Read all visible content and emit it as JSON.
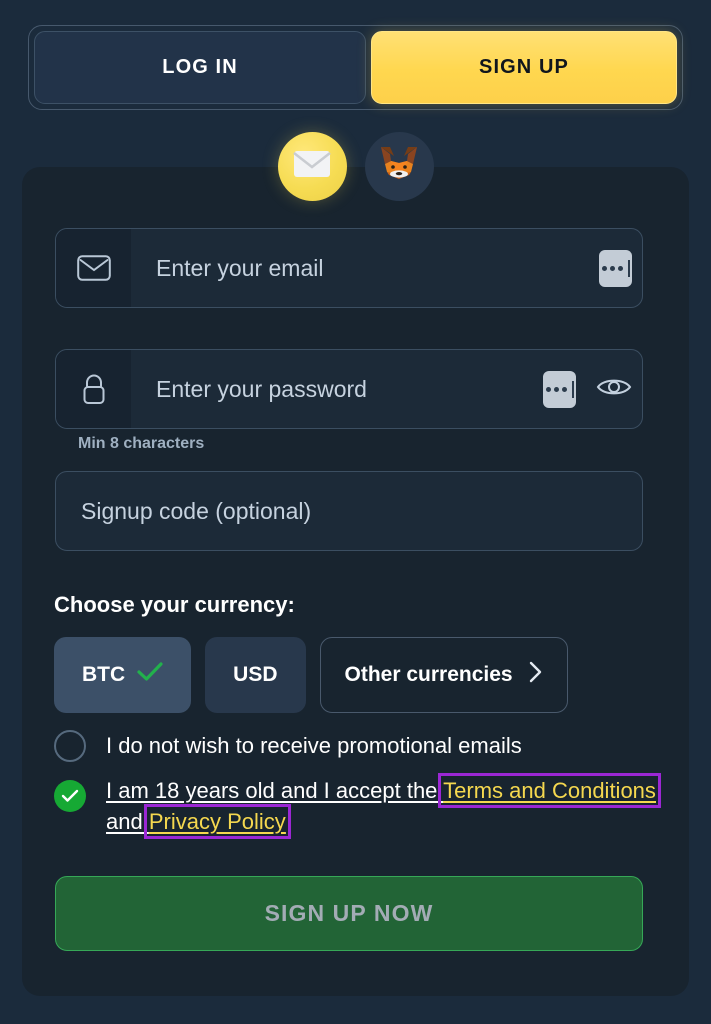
{
  "auth_tabs": {
    "login_label": "LOG IN",
    "signup_label": "SIGN UP",
    "active": "SIGN UP"
  },
  "providers": [
    {
      "name": "email",
      "icon": "envelope-icon",
      "selected": true
    },
    {
      "name": "metamask",
      "icon": "metamask-fox-icon",
      "selected": false
    }
  ],
  "form": {
    "email": {
      "icon": "envelope-icon",
      "placeholder": "Enter your email",
      "value": "",
      "autofill_icon": "autofill-dots-icon"
    },
    "password": {
      "icon": "lock-icon",
      "placeholder": "Enter your password",
      "value": "",
      "autofill_icon": "autofill-dots-icon",
      "reveal_icon": "eye-icon",
      "hint": "Min 8 characters"
    },
    "signup_code": {
      "placeholder": "Signup code (optional)",
      "value": ""
    }
  },
  "currency": {
    "label": "Choose your currency:",
    "options": [
      {
        "label": "BTC",
        "selected": true,
        "check_icon": "check-icon"
      },
      {
        "label": "USD",
        "selected": false
      },
      {
        "label": "Other currencies",
        "selected": false,
        "chevron_icon": "chevron-right-icon"
      }
    ]
  },
  "consents": [
    {
      "name": "promotional-emails",
      "checked": false,
      "label": "I do not wish to receive promotional emails"
    },
    {
      "name": "age-and-terms",
      "checked": true,
      "label_part1": "I am 18 years old and I accept the ",
      "link1": "Terms and Conditions",
      "label_part2": " and ",
      "link2": "Privacy Policy"
    }
  ],
  "submit": {
    "label": "SIGN UP NOW",
    "enabled": false
  },
  "colors": {
    "page_bg": "#1b2b3c",
    "card_bg": "#18242f",
    "accent_yellow": "#ffd74f",
    "link_yellow": "#f5d84f",
    "highlight_purple": "#9b27d4",
    "success_green": "#16a934",
    "submit_green": "#226436"
  }
}
